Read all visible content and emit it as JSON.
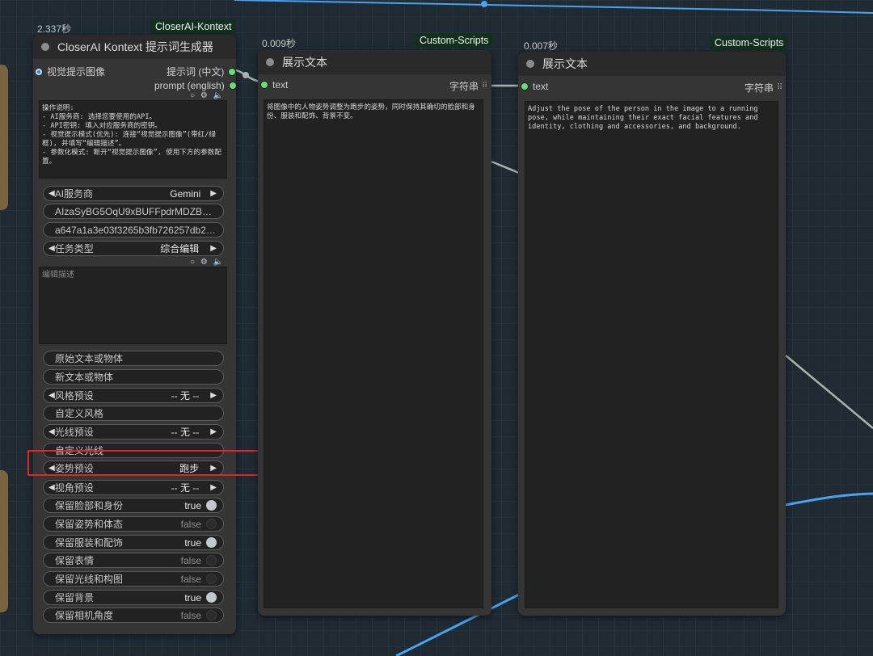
{
  "node_main": {
    "timing": "2.337秒",
    "badge": "CloserAI-Kontext",
    "title": "CloserAI Kontext 提示词生成器",
    "input_label": "视觉提示图像",
    "output_cn": "提示词 (中文)",
    "output_en": "prompt (english)",
    "instructions": "操作说明:\n- AI服务商: 选择您要使用的API。\n- API密钥: 填入对应服务商的密钥。\n- 视觉提示模式(优先): 连接“视觉提示图像”(带红/绿框), 并填写“编辑描述”。\n- 参数化模式: 断开“视觉提示图像”, 使用下方的参数配置。",
    "service": {
      "label": "AI服务商",
      "value": "Gemini"
    },
    "api_key_1": "AIzaSyBG5OqU9xBUFFpdrMDZBeL...",
    "api_key_2": "a647a1a3e03f3265b3fb726257db2e ...",
    "task": {
      "label": "任务类型",
      "value": "综合编辑"
    },
    "edit_placeholder": "编辑描述",
    "original_obj": "原始文本或物体",
    "new_obj": "新文本或物体",
    "style": {
      "label": "风格预设",
      "value": "-- 无 --"
    },
    "custom_style": "自定义风格",
    "light": {
      "label": "光线预设",
      "value": "-- 无 --"
    },
    "custom_light": "自定义光线",
    "pose": {
      "label": "姿势预设",
      "value": "跑步"
    },
    "view": {
      "label": "视角预设",
      "value": "-- 无 --"
    },
    "toggles": [
      {
        "label": "保留脸部和身份",
        "value": "true"
      },
      {
        "label": "保留姿势和体态",
        "value": "false"
      },
      {
        "label": "保留服装和配饰",
        "value": "true"
      },
      {
        "label": "保留表情",
        "value": "false"
      },
      {
        "label": "保留光线和构图",
        "value": "false"
      },
      {
        "label": "保留背景",
        "value": "true"
      },
      {
        "label": "保留相机角度",
        "value": "false"
      }
    ]
  },
  "node_cn": {
    "timing": "0.009秒",
    "badge": "Custom-Scripts",
    "title": "展示文本",
    "input": "text",
    "output": "字符串",
    "text": "将图像中的人物姿势调整为跑步的姿势，同时保持其确切的脸部和身份、服装和配饰、背景不变。"
  },
  "node_en": {
    "timing": "0.007秒",
    "badge": "Custom-Scripts",
    "title": "展示文本",
    "input": "text",
    "output": "字符串",
    "text": "Adjust the pose of the person in the image to a running pose, while maintaining their exact facial features and identity, clothing and accessories, and background."
  },
  "colors": {
    "link_blue": "#4aa3f0",
    "link_grey": "#a7b5ae",
    "socket_green": "#62e076",
    "badge_bg": "#13301f",
    "highlight_red": "#e0262a"
  }
}
